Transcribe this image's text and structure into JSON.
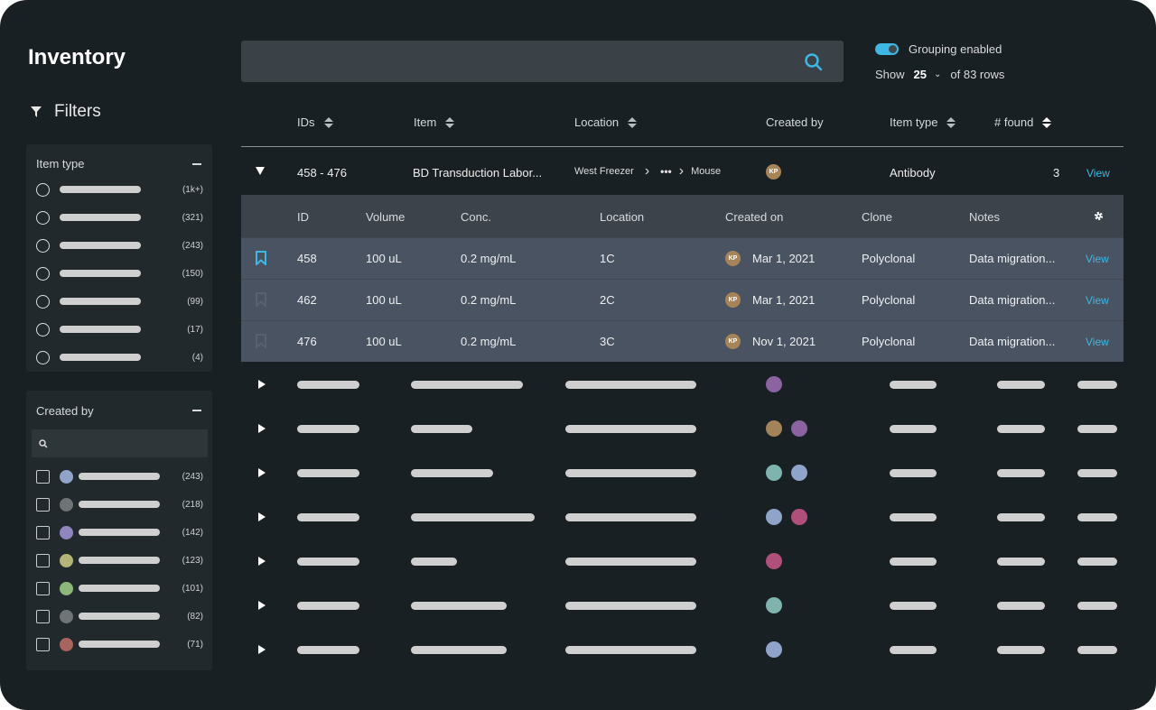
{
  "title": "Inventory",
  "filters_label": "Filters",
  "item_type_filter": {
    "label": "Item type",
    "counts": [
      "(1k+)",
      "(321)",
      "(243)",
      "(150)",
      "(99)",
      "(17)",
      "(4)"
    ]
  },
  "created_by_filter": {
    "label": "Created by",
    "search_placeholder": "",
    "items": [
      {
        "color": "#8fa4c8",
        "count": "(243)"
      },
      {
        "color": "#6f7577",
        "count": "(218)"
      },
      {
        "color": "#8f86c0",
        "count": "(142)"
      },
      {
        "color": "#b5b57a",
        "count": "(123)"
      },
      {
        "color": "#8db77a",
        "count": "(101)"
      },
      {
        "color": "#6f7577",
        "count": "(82)"
      },
      {
        "color": "#a8645f",
        "count": "(71)"
      }
    ]
  },
  "search": {
    "placeholder": ""
  },
  "grouping": {
    "label": "Grouping enabled",
    "enabled": true,
    "accent": "#3fb7e4"
  },
  "pagination": {
    "show": "Show",
    "value": "25",
    "of": "of 83 rows"
  },
  "columns": [
    "IDs",
    "Item",
    "Location",
    "Created by",
    "Item type",
    "# found"
  ],
  "group": {
    "ids": "458 - 476",
    "item": "BD Transduction Labor...",
    "loc_start": "West Freezer",
    "loc_end": "Mouse",
    "creator": "KP",
    "type": "Antibody",
    "found": "3",
    "view": "View"
  },
  "sub_columns": [
    "ID",
    "Volume",
    "Conc.",
    "Location",
    "Created on",
    "Clone",
    "Notes"
  ],
  "sub_rows": [
    {
      "id": "458",
      "volume": "100 uL",
      "conc": "0.2 mg/mL",
      "location": "1C",
      "creator": "KP",
      "created": "Mar 1, 2021",
      "clone": "Polyclonal",
      "notes": "Data migration...",
      "view": "View",
      "bookmarked": true
    },
    {
      "id": "462",
      "volume": "100 uL",
      "conc": "0.2 mg/mL",
      "location": "2C",
      "creator": "KP",
      "created": "Mar 1, 2021",
      "clone": "Polyclonal",
      "notes": "Data migration...",
      "view": "View",
      "bookmarked": false
    },
    {
      "id": "476",
      "volume": "100 uL",
      "conc": "0.2 mg/mL",
      "location": "3C",
      "creator": "KP",
      "created": "Nov 1, 2021",
      "clone": "Polyclonal",
      "notes": "Data migration...",
      "view": "View",
      "bookmarked": false
    }
  ],
  "collapsed_rows_avatar_colors": [
    [
      "#8a63a0"
    ],
    [
      "#a3845a",
      "#8a63a0"
    ],
    [
      "#7fb3ad",
      "#8fa4c8"
    ],
    [
      "#8fa4c8",
      "#b0507a"
    ],
    [
      "#b0507a"
    ],
    [
      "#7fb3ad"
    ],
    [
      "#8fa4c8"
    ]
  ]
}
